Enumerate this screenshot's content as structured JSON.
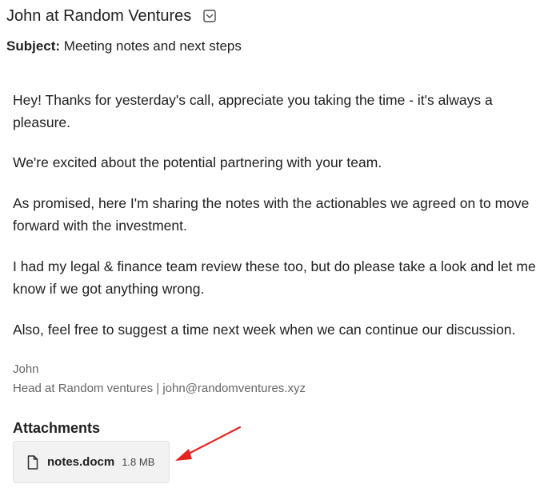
{
  "email": {
    "sender": "John at Random Ventures",
    "subject_label": "Subject:",
    "subject": "Meeting notes and next steps",
    "body": [
      "Hey! Thanks for yesterday's call, appreciate you taking the time - it's always a pleasure.",
      "We're excited about the potential partnering with your team.",
      "As promised, here I'm sharing the notes with the actionables we agreed on to move forward with the investment.",
      "I had my legal & finance team review these too, but do please take a look and let me know if we got anything wrong.",
      "Also, feel free to suggest a time next week when we can continue our discussion."
    ],
    "signature": {
      "name": "John",
      "details": "Head at Random ventures | john@randomventures.xyz"
    },
    "attachments_heading": "Attachments",
    "attachments": [
      {
        "name": "notes.docm",
        "size": "1.8 MB",
        "icon": "document-icon"
      }
    ]
  },
  "icons": {
    "expand": "chevron-down-box-icon",
    "annotation": "red-arrow-icon"
  },
  "colors": {
    "annotation_arrow": "#e8231e",
    "attachment_bg": "#f2f2f2",
    "signature_text": "#666666"
  }
}
